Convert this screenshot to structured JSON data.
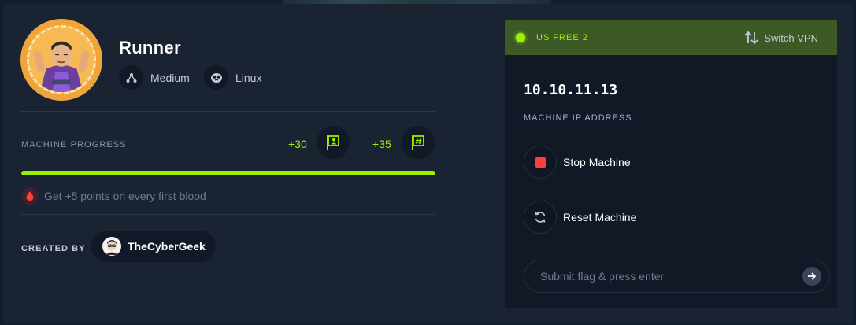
{
  "machine": {
    "name": "Runner",
    "difficulty": "Medium",
    "os": "Linux"
  },
  "progress": {
    "label": "MACHINE PROGRESS",
    "user_points": "+30",
    "root_points": "+35",
    "completion": 1.0
  },
  "first_blood_text": "Get +5 points on every first blood",
  "creator": {
    "label": "CREATED BY",
    "name": "TheCyberGeek"
  },
  "vpn": {
    "server": "US FREE 2",
    "switch_label": "Switch VPN",
    "status_color": "#9fef00"
  },
  "ip": {
    "address": "10.10.11.13",
    "label": "MACHINE IP ADDRESS"
  },
  "actions": {
    "stop_label": "Stop Machine",
    "reset_label": "Reset Machine"
  },
  "flag_input": {
    "placeholder": "Submit flag & press enter",
    "value": ""
  },
  "icons": {
    "difficulty": "difficulty-icon",
    "os": "linux-icon",
    "user_flag": "user-flag-icon",
    "root_flag": "root-flag-icon",
    "first_blood": "blood-drop-icon",
    "switch": "switch-arrows-icon",
    "stop": "stop-icon",
    "reset": "reset-icon",
    "submit": "arrow-right-icon"
  },
  "colors": {
    "accent": "#9fef00",
    "stop": "#ff3e3e",
    "background": "#141d2b",
    "card": "#1a2332",
    "panel": "#111927"
  }
}
